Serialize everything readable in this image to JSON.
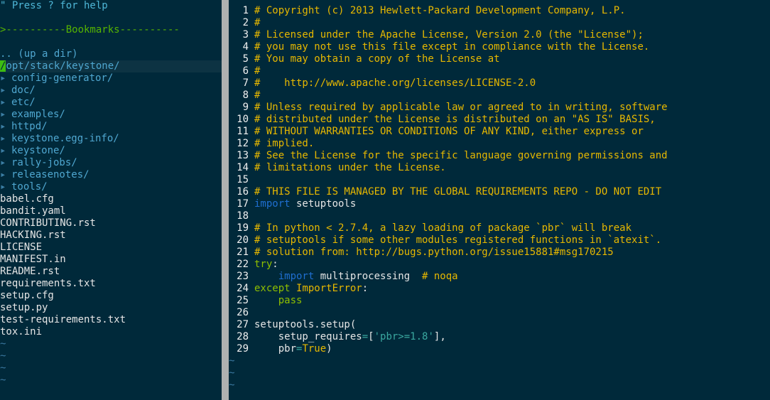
{
  "tree": {
    "help": "\" Press ? for help",
    "bookmarks": ">----------Bookmarks----------",
    "up_dir": ".. (up a dir)",
    "cursor_char": "/",
    "root": "opt/stack/keystone/",
    "dirs": [
      "config-generator/",
      "doc/",
      "etc/",
      "examples/",
      "httpd/",
      "keystone.egg-info/",
      "keystone/",
      "rally-jobs/",
      "releasenotes/",
      "tools/"
    ],
    "files": [
      "babel.cfg",
      "bandit.yaml",
      "CONTRIBUTING.rst",
      "HACKING.rst",
      "LICENSE",
      "MANIFEST.in",
      "README.rst",
      "requirements.txt",
      "setup.cfg",
      "setup.py",
      "test-requirements.txt",
      "tox.ini"
    ],
    "dir_arrow": "▸",
    "tilde": "~"
  },
  "editor": {
    "tilde": "~",
    "lines": [
      {
        "n": "1",
        "segs": [
          {
            "c": "cmt",
            "t": "# Copyright (c) 2013 Hewlett-Packard Development Company, L.P."
          }
        ]
      },
      {
        "n": "2",
        "segs": [
          {
            "c": "cmt",
            "t": "#"
          }
        ]
      },
      {
        "n": "3",
        "segs": [
          {
            "c": "cmt",
            "t": "# Licensed under the Apache License, Version 2.0 (the \"License\");"
          }
        ]
      },
      {
        "n": "4",
        "segs": [
          {
            "c": "cmt",
            "t": "# you may not use this file except in compliance with the License."
          }
        ]
      },
      {
        "n": "5",
        "segs": [
          {
            "c": "cmt",
            "t": "# You may obtain a copy of the License at"
          }
        ]
      },
      {
        "n": "6",
        "segs": [
          {
            "c": "cmt",
            "t": "#"
          }
        ]
      },
      {
        "n": "7",
        "segs": [
          {
            "c": "cmt",
            "t": "#    http://www.apache.org/licenses/LICENSE-2.0"
          }
        ]
      },
      {
        "n": "8",
        "segs": [
          {
            "c": "cmt",
            "t": "#"
          }
        ]
      },
      {
        "n": "9",
        "segs": [
          {
            "c": "cmt",
            "t": "# Unless required by applicable law or agreed to in writing, software"
          }
        ]
      },
      {
        "n": "10",
        "segs": [
          {
            "c": "cmt",
            "t": "# distributed under the License is distributed on an \"AS IS\" BASIS,"
          }
        ]
      },
      {
        "n": "11",
        "segs": [
          {
            "c": "cmt",
            "t": "# WITHOUT WARRANTIES OR CONDITIONS OF ANY KIND, either express or"
          }
        ]
      },
      {
        "n": "12",
        "segs": [
          {
            "c": "cmt",
            "t": "# implied."
          }
        ]
      },
      {
        "n": "13",
        "segs": [
          {
            "c": "cmt",
            "t": "# See the License for the specific language governing permissions and"
          }
        ]
      },
      {
        "n": "14",
        "segs": [
          {
            "c": "cmt",
            "t": "# limitations under the License."
          }
        ]
      },
      {
        "n": "15",
        "segs": []
      },
      {
        "n": "16",
        "segs": [
          {
            "c": "cmt",
            "t": "# THIS FILE IS MANAGED BY THE GLOBAL REQUIREMENTS REPO - DO NOT EDIT"
          }
        ]
      },
      {
        "n": "17",
        "segs": [
          {
            "c": "kw",
            "t": "import"
          },
          {
            "c": "txt",
            "t": " setuptools"
          }
        ]
      },
      {
        "n": "18",
        "segs": []
      },
      {
        "n": "19",
        "segs": [
          {
            "c": "cmt",
            "t": "# In python < 2.7.4, a lazy loading of package `pbr` will break"
          }
        ]
      },
      {
        "n": "20",
        "segs": [
          {
            "c": "cmt",
            "t": "# setuptools if some other modules registered functions in `atexit`."
          }
        ]
      },
      {
        "n": "21",
        "segs": [
          {
            "c": "cmt",
            "t": "# solution from: http://bugs.python.org/issue15881#msg170215"
          }
        ]
      },
      {
        "n": "22",
        "segs": [
          {
            "c": "kw2",
            "t": "try"
          },
          {
            "c": "txt",
            "t": ":"
          }
        ]
      },
      {
        "n": "23",
        "segs": [
          {
            "c": "txt",
            "t": "    "
          },
          {
            "c": "kw",
            "t": "import"
          },
          {
            "c": "txt",
            "t": " multiprocessing  "
          },
          {
            "c": "cmt",
            "t": "# noqa"
          }
        ]
      },
      {
        "n": "24",
        "segs": [
          {
            "c": "kw2",
            "t": "except"
          },
          {
            "c": "txt",
            "t": " "
          },
          {
            "c": "exc",
            "t": "ImportError"
          },
          {
            "c": "txt",
            "t": ":"
          }
        ]
      },
      {
        "n": "25",
        "segs": [
          {
            "c": "txt",
            "t": "    "
          },
          {
            "c": "kw2",
            "t": "pass"
          }
        ]
      },
      {
        "n": "26",
        "segs": []
      },
      {
        "n": "27",
        "segs": [
          {
            "c": "txt",
            "t": "setuptools.setup("
          }
        ]
      },
      {
        "n": "28",
        "segs": [
          {
            "c": "txt",
            "t": "    setup_requires"
          },
          {
            "c": "op",
            "t": "="
          },
          {
            "c": "txt",
            "t": "["
          },
          {
            "c": "str",
            "t": "'pbr>=1.8'"
          },
          {
            "c": "txt",
            "t": "],"
          }
        ]
      },
      {
        "n": "29",
        "segs": [
          {
            "c": "txt",
            "t": "    pbr"
          },
          {
            "c": "op",
            "t": "="
          },
          {
            "c": "exc",
            "t": "True"
          },
          {
            "c": "txt",
            "t": ")"
          }
        ]
      }
    ]
  }
}
